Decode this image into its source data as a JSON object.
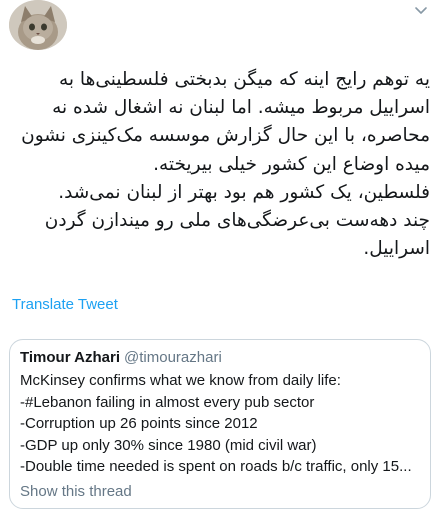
{
  "tweet": {
    "avatar_icon": "cat-avatar-icon",
    "menu_icon": "chevron-down-icon",
    "text_lines": [
      "یه توهم رایج اینه که میگن بدبختی فلسطینی‌ها به",
      "اسراییل مربوط میشه. اما لبنان نه اشغال شده نه",
      "محاصره، با این حال گزارش موسسه مک‌کینزی نشون",
      "میده اوضاع این کشور خیلی بیریخته.",
      "فلسطین، یک کشور هم بود بهتر از لبنان نمی‌شد.",
      "چند دهه‌ست بی‌عرضگی‌های ملی رو میندازن گردن",
      "اسراییل."
    ],
    "translate_label": "Translate Tweet"
  },
  "quoted_tweet": {
    "author_name": "Timour Azhari",
    "author_handle": "@timourazhari",
    "lines": [
      "McKinsey confirms what we know from daily life:",
      "-#Lebanon failing in almost every pub sector",
      "-Corruption up 26 points since 2012",
      "-GDP up only 30% since 1980 (mid civil war)",
      "-Double time needed is spent on roads b/c traffic, only 15..."
    ],
    "show_thread_label": "Show this thread"
  },
  "colors": {
    "link": "#1da1f2",
    "secondary": "#657786",
    "border": "#ccd6dd",
    "text": "#14171a"
  }
}
